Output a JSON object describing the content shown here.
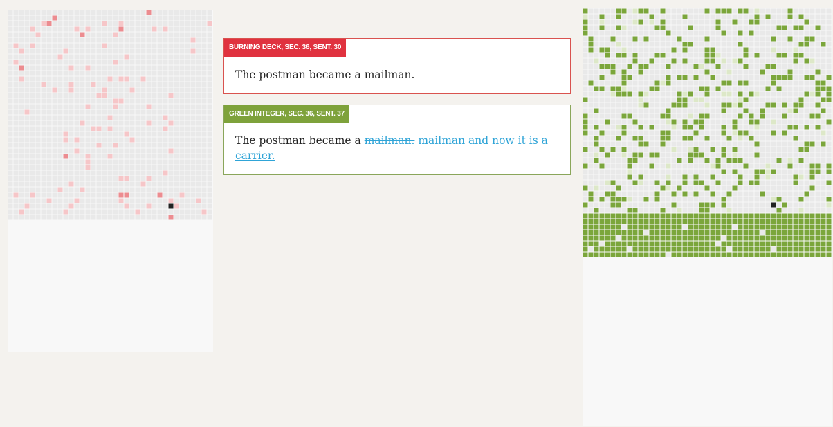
{
  "colors": {
    "background": "#f4f2ee",
    "empty_cell": "#e9e9e9",
    "cell_line": "#d6d6d6",
    "red_light": "#f6c6c8",
    "red_medium": "#ec8c90",
    "green_light": "#dde8c8",
    "green_dark": "#7ba63b",
    "current_cell": "#222222",
    "link": "#2fa4d7"
  },
  "left_grid": {
    "edition": "Burning Deck",
    "highlights_light": [
      [
        0,
        25
      ],
      [
        2,
        6
      ],
      [
        2,
        17
      ],
      [
        2,
        20
      ],
      [
        2,
        36
      ],
      [
        3,
        4
      ],
      [
        3,
        12
      ],
      [
        3,
        14
      ],
      [
        3,
        28
      ],
      [
        3,
        26
      ],
      [
        4,
        5
      ],
      [
        4,
        19
      ],
      [
        5,
        33
      ],
      [
        6,
        1
      ],
      [
        6,
        4
      ],
      [
        6,
        17
      ],
      [
        7,
        2
      ],
      [
        7,
        33
      ],
      [
        7,
        10
      ],
      [
        8,
        9
      ],
      [
        8,
        21
      ],
      [
        9,
        1
      ],
      [
        9,
        19
      ],
      [
        10,
        14
      ],
      [
        10,
        11
      ],
      [
        12,
        2
      ],
      [
        12,
        18
      ],
      [
        12,
        20
      ],
      [
        12,
        21
      ],
      [
        12,
        24
      ],
      [
        13,
        6
      ],
      [
        13,
        11
      ],
      [
        13,
        15
      ],
      [
        14,
        8
      ],
      [
        14,
        11
      ],
      [
        14,
        17
      ],
      [
        14,
        22
      ],
      [
        15,
        16
      ],
      [
        15,
        17
      ],
      [
        15,
        29
      ],
      [
        16,
        19
      ],
      [
        16,
        20
      ],
      [
        17,
        14
      ],
      [
        17,
        19
      ],
      [
        17,
        25
      ],
      [
        18,
        3
      ],
      [
        19,
        18
      ],
      [
        19,
        28
      ],
      [
        20,
        13
      ],
      [
        20,
        29
      ],
      [
        20,
        25
      ],
      [
        21,
        15
      ],
      [
        21,
        16
      ],
      [
        21,
        18
      ],
      [
        21,
        28
      ],
      [
        22,
        10
      ],
      [
        22,
        21
      ],
      [
        23,
        10
      ],
      [
        23,
        12
      ],
      [
        23,
        22
      ],
      [
        24,
        16
      ],
      [
        24,
        19
      ],
      [
        25,
        12
      ],
      [
        25,
        29
      ],
      [
        26,
        14
      ],
      [
        26,
        18
      ],
      [
        27,
        14
      ],
      [
        28,
        14
      ],
      [
        29,
        28
      ],
      [
        30,
        25
      ],
      [
        30,
        20
      ],
      [
        30,
        21
      ],
      [
        31,
        11
      ],
      [
        31,
        24
      ],
      [
        32,
        9
      ],
      [
        32,
        13
      ],
      [
        33,
        1
      ],
      [
        33,
        4
      ],
      [
        33,
        31
      ],
      [
        34,
        7
      ],
      [
        34,
        12
      ],
      [
        34,
        20
      ],
      [
        34,
        29
      ],
      [
        34,
        34
      ],
      [
        35,
        3
      ],
      [
        35,
        11
      ],
      [
        35,
        21
      ],
      [
        35,
        25
      ],
      [
        35,
        30
      ],
      [
        36,
        2
      ],
      [
        36,
        10
      ],
      [
        36,
        35
      ],
      [
        36,
        23
      ]
    ],
    "highlights_medium": [
      [
        0,
        25
      ],
      [
        1,
        8
      ],
      [
        2,
        7
      ],
      [
        4,
        13
      ],
      [
        3,
        20
      ],
      [
        10,
        2
      ],
      [
        26,
        10
      ],
      [
        33,
        20
      ],
      [
        33,
        21
      ],
      [
        33,
        27
      ],
      [
        37,
        29
      ]
    ],
    "current_cell": [
      35,
      29
    ]
  },
  "right_grid": {
    "edition": "Green Integer",
    "solid_from_row": 37,
    "solid_gaps": [
      [
        39,
        7
      ],
      [
        39,
        18
      ],
      [
        39,
        27
      ],
      [
        40,
        11
      ],
      [
        40,
        32
      ],
      [
        41,
        6
      ],
      [
        41,
        25
      ],
      [
        42,
        3
      ],
      [
        42,
        24
      ],
      [
        43,
        1
      ],
      [
        43,
        8
      ],
      [
        43,
        26
      ],
      [
        43,
        34
      ],
      [
        44,
        15
      ]
    ],
    "current_cell": [
      35,
      34
    ]
  },
  "card_a": {
    "label": "BURNING DECK, SEC. 36, SENT. 30",
    "text": "The postman became a mailman."
  },
  "card_b": {
    "label": "GREEN INTEGER, SEC. 36, SENT. 37",
    "text_prefix": "The postman became a ",
    "deleted": "mailman.",
    "inserted": "mailman and now it is a carrier."
  }
}
